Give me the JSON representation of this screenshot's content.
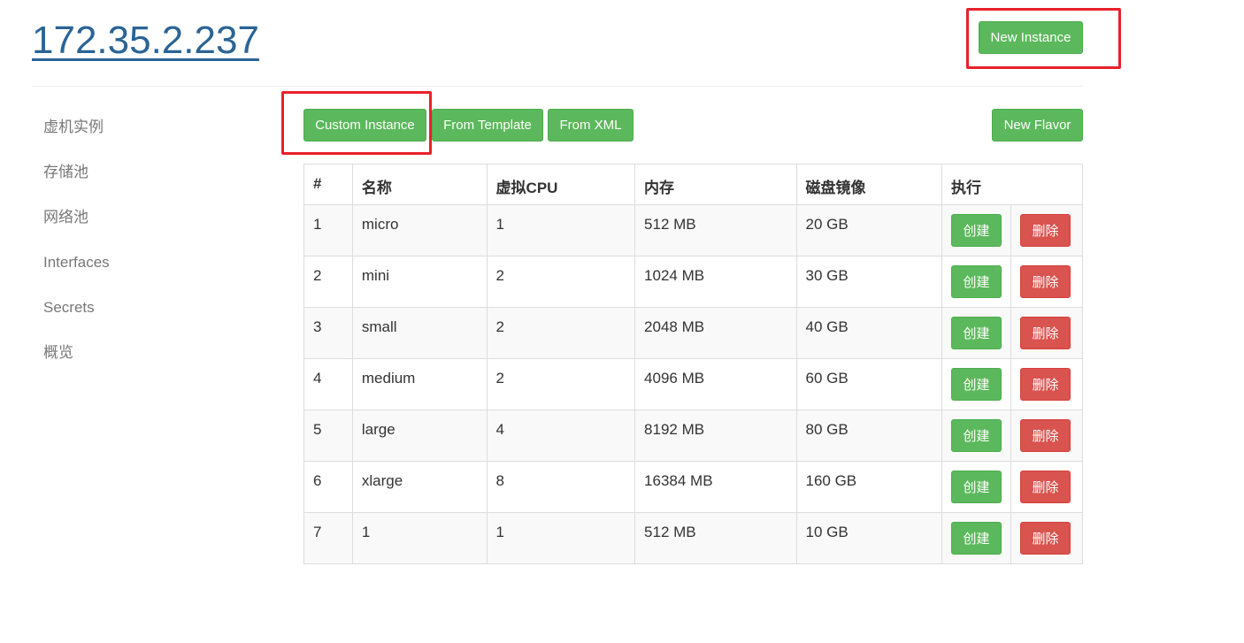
{
  "header": {
    "host_title": "172.35.2.237",
    "new_instance_label": "New Instance"
  },
  "sidebar": {
    "items": [
      {
        "label": "虚机实例"
      },
      {
        "label": "存储池"
      },
      {
        "label": "网络池"
      },
      {
        "label": "Interfaces"
      },
      {
        "label": "Secrets"
      },
      {
        "label": "概览"
      }
    ]
  },
  "toolbar": {
    "custom_instance_label": "Custom Instance",
    "from_template_label": "From Template",
    "from_xml_label": "From XML",
    "new_flavor_label": "New Flavor"
  },
  "table": {
    "headers": [
      "#",
      "名称",
      "虚拟CPU",
      "内存",
      "磁盘镜像",
      "执行"
    ],
    "create_label": "创建",
    "delete_label": "删除",
    "rows": [
      {
        "id": "1",
        "name": "micro",
        "vcpu": "1",
        "memory": "512 MB",
        "disk": "20 GB"
      },
      {
        "id": "2",
        "name": "mini",
        "vcpu": "2",
        "memory": "1024 MB",
        "disk": "30 GB"
      },
      {
        "id": "3",
        "name": "small",
        "vcpu": "2",
        "memory": "2048 MB",
        "disk": "40 GB"
      },
      {
        "id": "4",
        "name": "medium",
        "vcpu": "2",
        "memory": "4096 MB",
        "disk": "60 GB"
      },
      {
        "id": "5",
        "name": "large",
        "vcpu": "4",
        "memory": "8192 MB",
        "disk": "80 GB"
      },
      {
        "id": "6",
        "name": "xlarge",
        "vcpu": "8",
        "memory": "16384 MB",
        "disk": "160 GB"
      },
      {
        "id": "7",
        "name": "1",
        "vcpu": "1",
        "memory": "512 MB",
        "disk": "10 GB"
      }
    ]
  },
  "colors": {
    "success": "#5cb85c",
    "danger": "#d9534f",
    "link": "#2a6496",
    "annotation_red": "#e8212a"
  }
}
